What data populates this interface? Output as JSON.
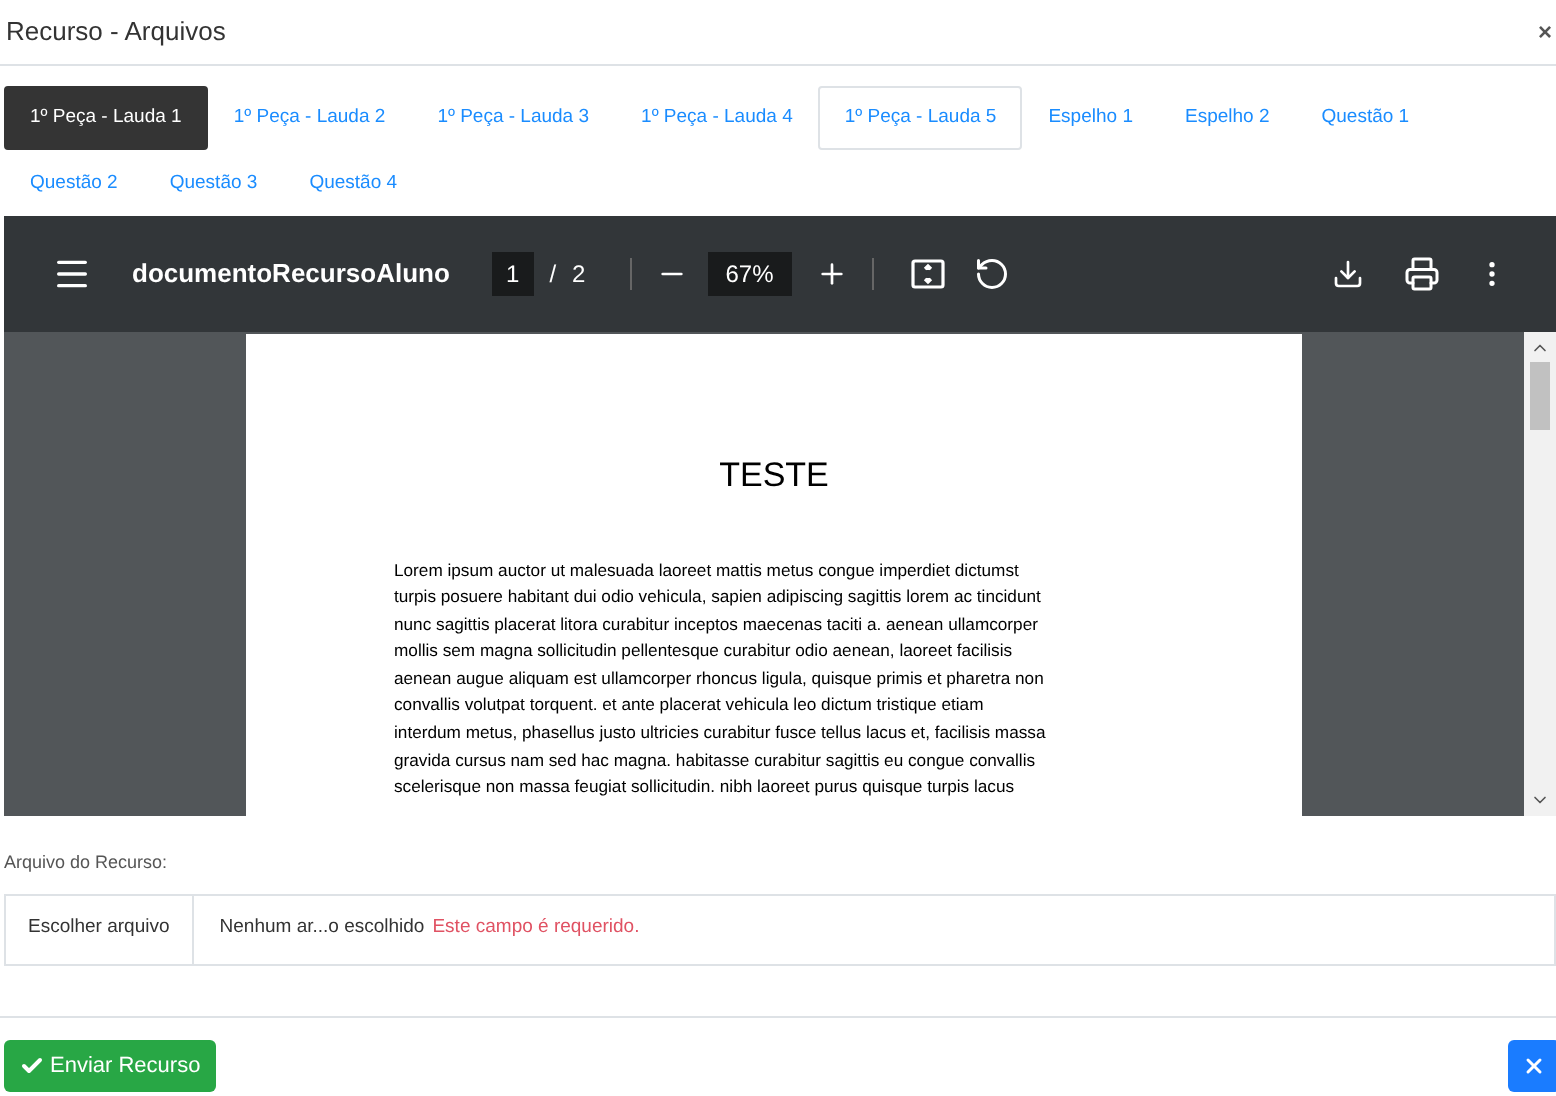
{
  "modal": {
    "title": "Recurso - Arquivos",
    "close": "×"
  },
  "tabs": [
    {
      "label": "1º Peça - Lauda 1",
      "selected": true,
      "outlined": false
    },
    {
      "label": "1º Peça - Lauda 2",
      "selected": false,
      "outlined": false
    },
    {
      "label": "1º Peça - Lauda 3",
      "selected": false,
      "outlined": false
    },
    {
      "label": "1º Peça - Lauda 4",
      "selected": false,
      "outlined": false
    },
    {
      "label": "1º Peça - Lauda 5",
      "selected": false,
      "outlined": true
    },
    {
      "label": "Espelho 1",
      "selected": false,
      "outlined": false
    },
    {
      "label": "Espelho 2",
      "selected": false,
      "outlined": false
    },
    {
      "label": "Questão 1",
      "selected": false,
      "outlined": false
    },
    {
      "label": "Questão 2",
      "selected": false,
      "outlined": false
    },
    {
      "label": "Questão 3",
      "selected": false,
      "outlined": false
    },
    {
      "label": "Questão 4",
      "selected": false,
      "outlined": false
    }
  ],
  "pdf_viewer": {
    "filename": "documentoRecursoAluno",
    "page": "1",
    "separator": "/",
    "total_pages": "2",
    "zoom": "67%",
    "document": {
      "heading": "TESTE",
      "lines": [
        "Lorem ipsum auctor ut malesuada laoreet mattis metus congue imperdiet dictumst",
        "turpis posuere habitant dui odio vehicula, sapien adipiscing sagittis lorem ac tincidunt",
        "nunc sagittis placerat litora curabitur inceptos maecenas taciti a. aenean ullamcorper",
        "mollis sem magna sollicitudin pellentesque curabitur odio aenean, laoreet facilisis",
        "aenean augue aliquam est ullamcorper rhoncus ligula, quisque primis et pharetra non",
        "convallis volutpat torquent. et ante placerat vehicula leo dictum tristique etiam",
        "interdum metus, phasellus justo ultricies curabitur fusce tellus lacus et, facilisis massa",
        "gravida cursus nam sed hac magna. habitasse curabitur sagittis eu congue convallis",
        "scelerisque non massa feugiat sollicitudin. nibh laoreet purus quisque turpis lacus"
      ]
    }
  },
  "upload": {
    "label": "Arquivo do Recurso:",
    "button": "Escolher arquivo",
    "file_name": "Nenhum ar...o escolhido",
    "error": "Este campo é requerido."
  },
  "footer": {
    "submit": "Enviar Recurso"
  }
}
